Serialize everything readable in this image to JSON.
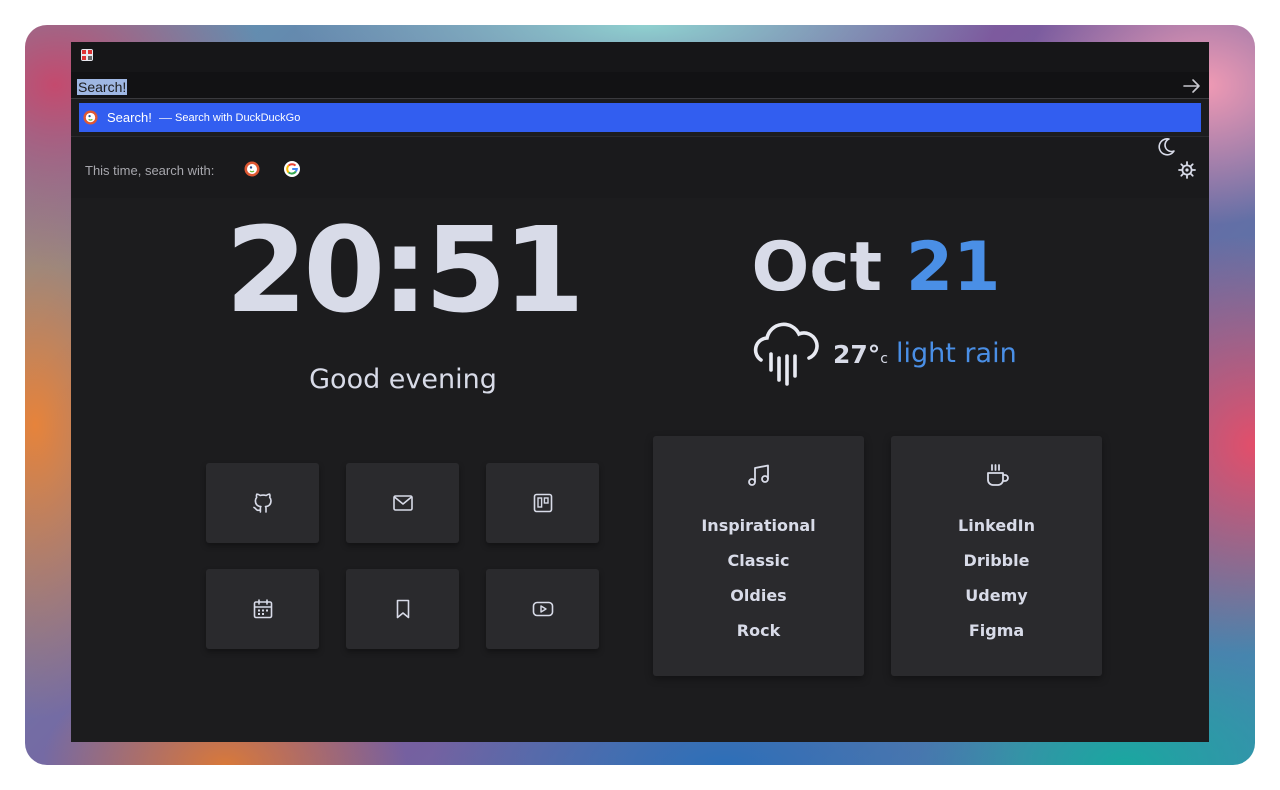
{
  "browser": {
    "url_text": "Search!",
    "suggestion": {
      "main": "Search!",
      "dash": "—",
      "sub": "Search with DuckDuckGo"
    },
    "one_time_search": {
      "label": "This time, search with:",
      "engines": [
        "duckduckgo-icon",
        "google-icon"
      ]
    }
  },
  "page": {
    "time": "20:51",
    "greeting": "Good evening",
    "date": {
      "month": "Oct",
      "day": "21"
    },
    "weather": {
      "icon": "rain-cloud-icon",
      "temp": "27°",
      "unit": "c",
      "condition": "light rain"
    },
    "shortcuts": [
      "github-icon",
      "mail-icon",
      "trello-icon",
      "calendar-icon",
      "bookmark-icon",
      "youtube-icon"
    ],
    "cards": [
      {
        "icon": "music-icon",
        "items": [
          "Inspirational",
          "Classic",
          "Oldies",
          "Rock"
        ]
      },
      {
        "icon": "coffee-icon",
        "items": [
          "LinkedIn",
          "Dribble",
          "Udemy",
          "Figma"
        ]
      }
    ]
  },
  "colors": {
    "accent": "#4a8fe6",
    "suggestion_bg": "#325ef0",
    "text": "#d8dbe8",
    "window_bg": "#1c1c1e",
    "tile_bg": "#2a2a2d"
  }
}
